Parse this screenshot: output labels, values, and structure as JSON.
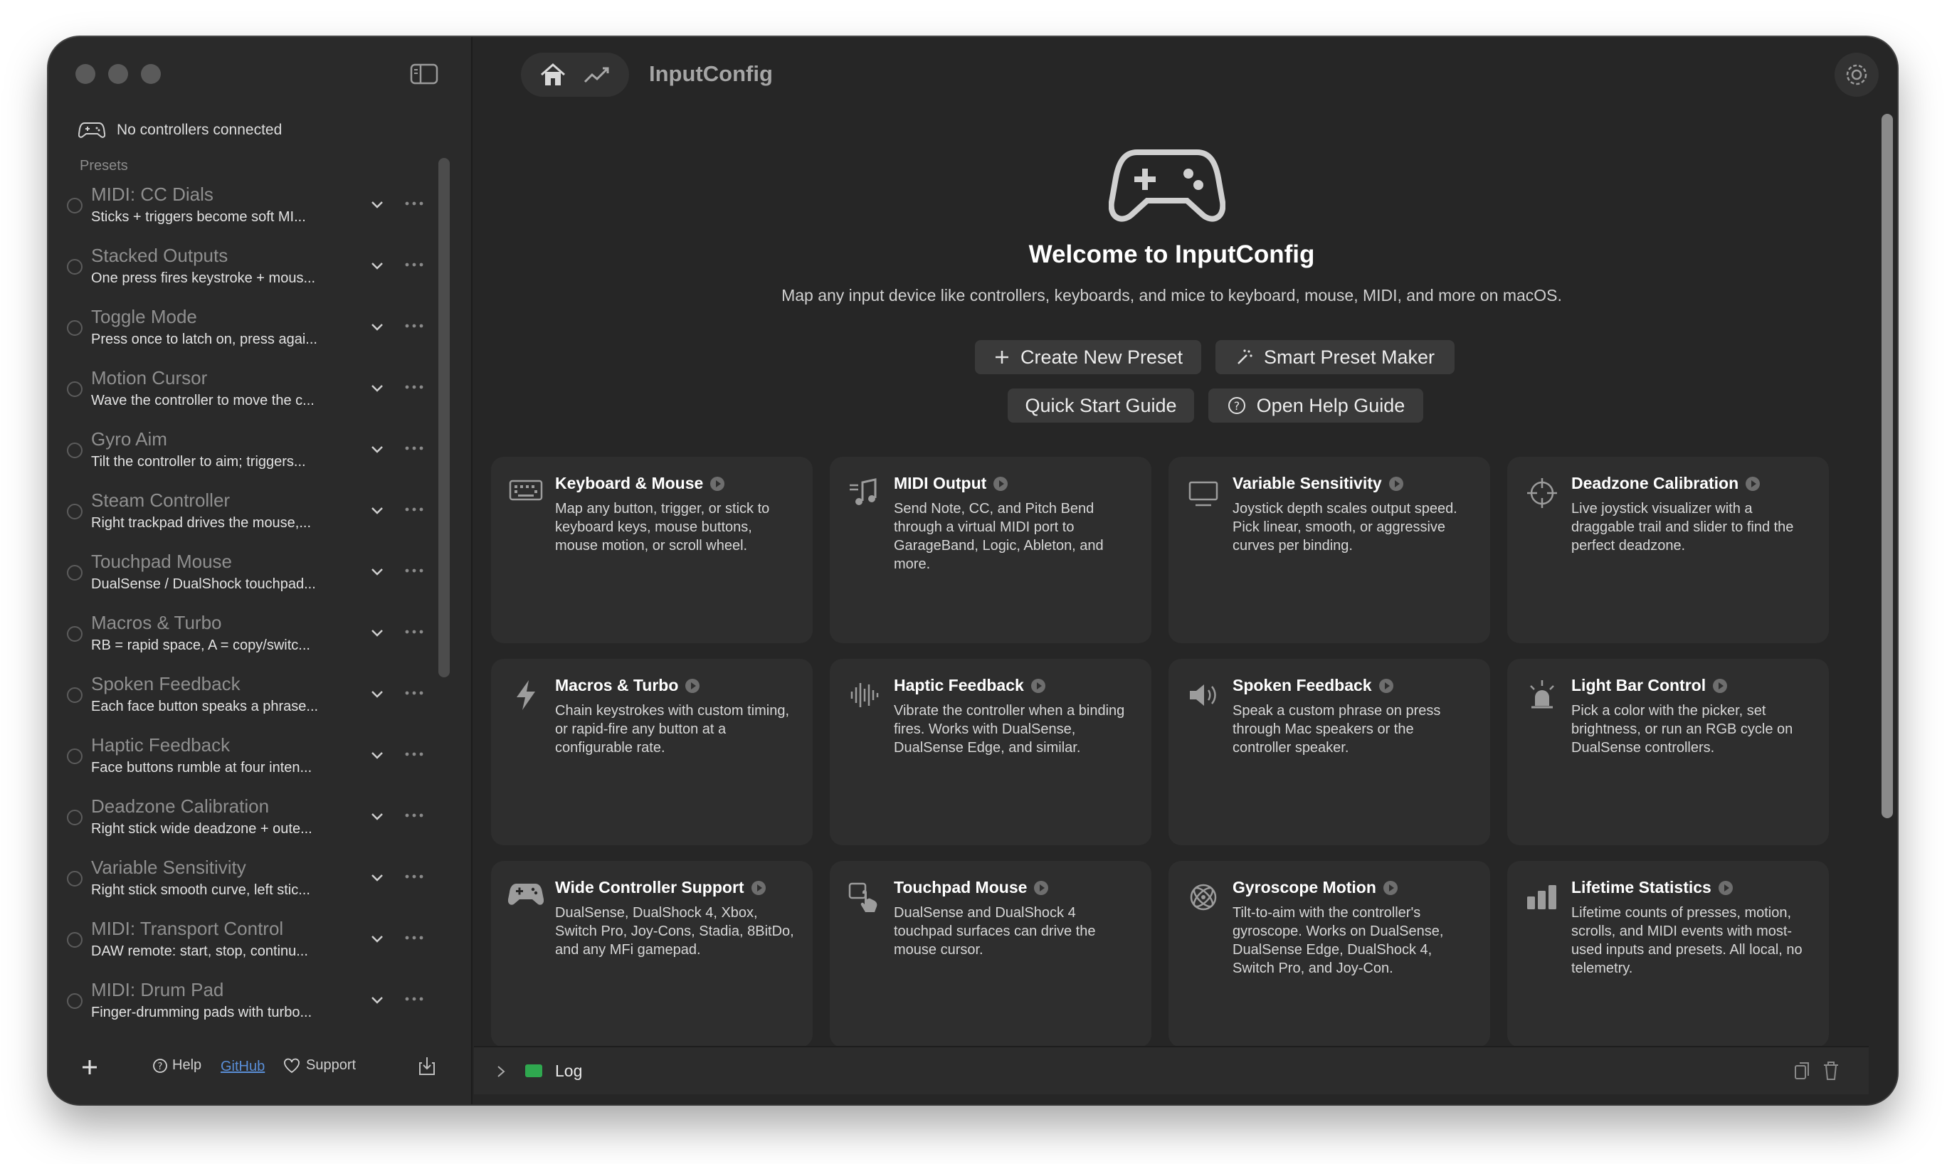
{
  "window": {
    "app_title": "InputConfig"
  },
  "sidebar": {
    "controllers_status": "No controllers connected",
    "presets_label": "Presets",
    "presets": [
      {
        "title": "MIDI: CC Dials",
        "subtitle": "Sticks + triggers become soft MI..."
      },
      {
        "title": "Stacked Outputs",
        "subtitle": "One press fires keystroke + mous..."
      },
      {
        "title": "Toggle Mode",
        "subtitle": "Press once to latch on, press agai..."
      },
      {
        "title": "Motion Cursor",
        "subtitle": "Wave the controller to move the c..."
      },
      {
        "title": "Gyro Aim",
        "subtitle": "Tilt the controller to aim; triggers..."
      },
      {
        "title": "Steam Controller",
        "subtitle": "Right trackpad drives the mouse,..."
      },
      {
        "title": "Touchpad Mouse",
        "subtitle": "DualSense / DualShock touchpad..."
      },
      {
        "title": "Macros & Turbo",
        "subtitle": "RB = rapid space, A = copy/switc..."
      },
      {
        "title": "Spoken Feedback",
        "subtitle": "Each face button speaks a phrase..."
      },
      {
        "title": "Haptic Feedback",
        "subtitle": "Face buttons rumble at four inten..."
      },
      {
        "title": "Deadzone Calibration",
        "subtitle": "Right stick wide deadzone + oute..."
      },
      {
        "title": "Variable Sensitivity",
        "subtitle": "Right stick smooth curve, left stic..."
      },
      {
        "title": "MIDI: Transport Control",
        "subtitle": "DAW remote: start, stop, continu..."
      },
      {
        "title": "MIDI: Drum Pad",
        "subtitle": "Finger-drumming pads with turbo..."
      }
    ],
    "footer": {
      "help": "Help",
      "github": "GitHub",
      "support": "Support"
    }
  },
  "main": {
    "welcome_title": "Welcome to InputConfig",
    "tagline": "Map any input device like controllers, keyboards, and mice to keyboard, mouse, MIDI, and more on macOS.",
    "buttons": {
      "create": "Create New Preset",
      "smart": "Smart Preset Maker",
      "quick_start": "Quick Start Guide",
      "help_guide": "Open Help Guide"
    },
    "features": [
      {
        "title": "Keyboard & Mouse",
        "icon": "keyboard-icon",
        "desc": "Map any button, trigger, or stick to keyboard keys, mouse buttons, mouse motion, or scroll wheel."
      },
      {
        "title": "MIDI Output",
        "icon": "music-note-icon",
        "desc": "Send Note, CC, and Pitch Bend through a virtual MIDI port to GarageBand, Logic, Ableton, and more."
      },
      {
        "title": "Variable Sensitivity",
        "icon": "display-icon",
        "desc": "Joystick depth scales output speed. Pick linear, smooth, or aggressive curves per binding."
      },
      {
        "title": "Deadzone Calibration",
        "icon": "crosshair-icon",
        "desc": "Live joystick visualizer with a draggable trail and slider to find the perfect deadzone."
      },
      {
        "title": "Macros & Turbo",
        "icon": "bolt-icon",
        "desc": "Chain keystrokes with custom timing, or rapid-fire any button at a configurable rate."
      },
      {
        "title": "Haptic Feedback",
        "icon": "waveform-icon",
        "desc": "Vibrate the controller when a binding fires. Works with DualSense, DualSense Edge, and similar."
      },
      {
        "title": "Spoken Feedback",
        "icon": "speaker-icon",
        "desc": "Speak a custom phrase on press through Mac speakers or the controller speaker."
      },
      {
        "title": "Light Bar Control",
        "icon": "light-icon",
        "desc": "Pick a color with the picker, set brightness, or run an RGB cycle on DualSense controllers."
      },
      {
        "title": "Wide Controller Support",
        "icon": "gamepad-icon",
        "desc": "DualSense, DualShock 4, Xbox, Switch Pro, Joy-Cons, Stadia, 8BitDo, and any MFi gamepad."
      },
      {
        "title": "Touchpad Mouse",
        "icon": "hand-point-icon",
        "desc": "DualSense and DualShock 4 touchpad surfaces can drive the mouse cursor."
      },
      {
        "title": "Gyroscope Motion",
        "icon": "gyroscope-icon",
        "desc": "Tilt-to-aim with the controller's gyroscope. Works on DualSense, DualSense Edge, DualShock 4, Switch Pro, and Joy-Con."
      },
      {
        "title": "Lifetime Statistics",
        "icon": "bar-chart-icon",
        "desc": "Lifetime counts of presses, motion, scrolls, and MIDI events with most-used inputs and presets. All local, no telemetry."
      }
    ],
    "log_label": "Log"
  }
}
